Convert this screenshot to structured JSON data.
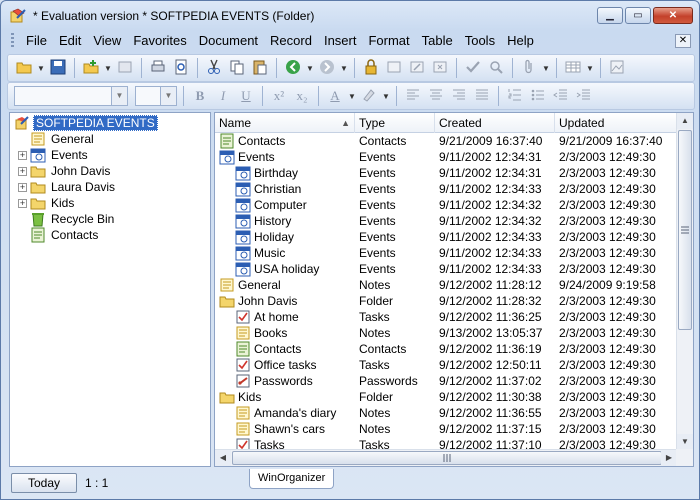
{
  "window": {
    "title": "* Evaluation version * SOFTPEDIA EVENTS (Folder)",
    "watermark": "SOFTPEDIA"
  },
  "menu": [
    {
      "label": "File"
    },
    {
      "label": "Edit"
    },
    {
      "label": "View"
    },
    {
      "label": "Favorites"
    },
    {
      "label": "Document"
    },
    {
      "label": "Record"
    },
    {
      "label": "Insert"
    },
    {
      "label": "Format"
    },
    {
      "label": "Table"
    },
    {
      "label": "Tools"
    },
    {
      "label": "Help"
    }
  ],
  "tree": {
    "root": "SOFTPEDIA EVENTS",
    "items": [
      {
        "label": "General",
        "icon": "notes-icon"
      },
      {
        "label": "Events",
        "icon": "events-icon"
      },
      {
        "label": "John Davis",
        "icon": "folder-icon"
      },
      {
        "label": "Laura Davis",
        "icon": "folder-icon"
      },
      {
        "label": "Kids",
        "icon": "folder-icon"
      },
      {
        "label": "Recycle Bin",
        "icon": "recycle-bin-icon"
      },
      {
        "label": "Contacts",
        "icon": "contacts-icon"
      }
    ]
  },
  "list": {
    "columns": {
      "name": "Name",
      "type": "Type",
      "created": "Created",
      "updated": "Updated"
    },
    "rows": [
      {
        "name": "Contacts",
        "type": "Contacts",
        "created": "9/21/2009 16:37:40",
        "updated": "9/21/2009 16:37:40",
        "icon": "contacts-icon"
      },
      {
        "name": "Events",
        "type": "Events",
        "created": "9/11/2002 12:34:31",
        "updated": "2/3/2003 12:49:30",
        "icon": "events-icon"
      },
      {
        "name": "Birthday",
        "type": "Events",
        "created": "9/11/2002 12:34:31",
        "updated": "2/3/2003 12:49:30",
        "icon": "events-icon"
      },
      {
        "name": "Christian",
        "type": "Events",
        "created": "9/11/2002 12:34:33",
        "updated": "2/3/2003 12:49:30",
        "icon": "events-icon"
      },
      {
        "name": "Computer",
        "type": "Events",
        "created": "9/11/2002 12:34:32",
        "updated": "2/3/2003 12:49:30",
        "icon": "events-icon"
      },
      {
        "name": "History",
        "type": "Events",
        "created": "9/11/2002 12:34:32",
        "updated": "2/3/2003 12:49:30",
        "icon": "events-icon"
      },
      {
        "name": "Holiday",
        "type": "Events",
        "created": "9/11/2002 12:34:33",
        "updated": "2/3/2003 12:49:30",
        "icon": "events-icon"
      },
      {
        "name": "Music",
        "type": "Events",
        "created": "9/11/2002 12:34:33",
        "updated": "2/3/2003 12:49:30",
        "icon": "events-icon"
      },
      {
        "name": "USA holiday",
        "type": "Events",
        "created": "9/11/2002 12:34:33",
        "updated": "2/3/2003 12:49:30",
        "icon": "events-icon"
      },
      {
        "name": "General",
        "type": "Notes",
        "created": "9/12/2002 11:28:12",
        "updated": "9/24/2009 9:19:58",
        "icon": "notes-icon"
      },
      {
        "name": "John Davis",
        "type": "Folder",
        "created": "9/12/2002 11:28:32",
        "updated": "2/3/2003 12:49:30",
        "icon": "folder-icon"
      },
      {
        "name": "At home",
        "type": "Tasks",
        "created": "9/12/2002 11:36:25",
        "updated": "2/3/2003 12:49:30",
        "icon": "tasks-icon"
      },
      {
        "name": "Books",
        "type": "Notes",
        "created": "9/13/2002 13:05:37",
        "updated": "2/3/2003 12:49:30",
        "icon": "notes-icon"
      },
      {
        "name": "Contacts",
        "type": "Contacts",
        "created": "9/12/2002 11:36:19",
        "updated": "2/3/2003 12:49:30",
        "icon": "contacts-icon"
      },
      {
        "name": "Office tasks",
        "type": "Tasks",
        "created": "9/12/2002 12:50:11",
        "updated": "2/3/2003 12:49:30",
        "icon": "tasks-icon"
      },
      {
        "name": "Passwords",
        "type": "Passwords",
        "created": "9/12/2002 11:37:02",
        "updated": "2/3/2003 12:49:30",
        "icon": "passwords-icon"
      },
      {
        "name": "Kids",
        "type": "Folder",
        "created": "9/12/2002 11:30:38",
        "updated": "2/3/2003 12:49:30",
        "icon": "folder-icon"
      },
      {
        "name": "Amanda's diary",
        "type": "Notes",
        "created": "9/12/2002 11:36:55",
        "updated": "2/3/2003 12:49:30",
        "icon": "notes-icon"
      },
      {
        "name": "Shawn's cars",
        "type": "Notes",
        "created": "9/12/2002 11:37:15",
        "updated": "2/3/2003 12:49:30",
        "icon": "notes-icon"
      },
      {
        "name": "Tasks",
        "type": "Tasks",
        "created": "9/12/2002 11:37:10",
        "updated": "2/3/2003 12:49:30",
        "icon": "tasks-icon"
      }
    ]
  },
  "status": {
    "today_label": "Today",
    "page_indicator": "1 : 1",
    "tab_label": "WinOrganizer"
  }
}
